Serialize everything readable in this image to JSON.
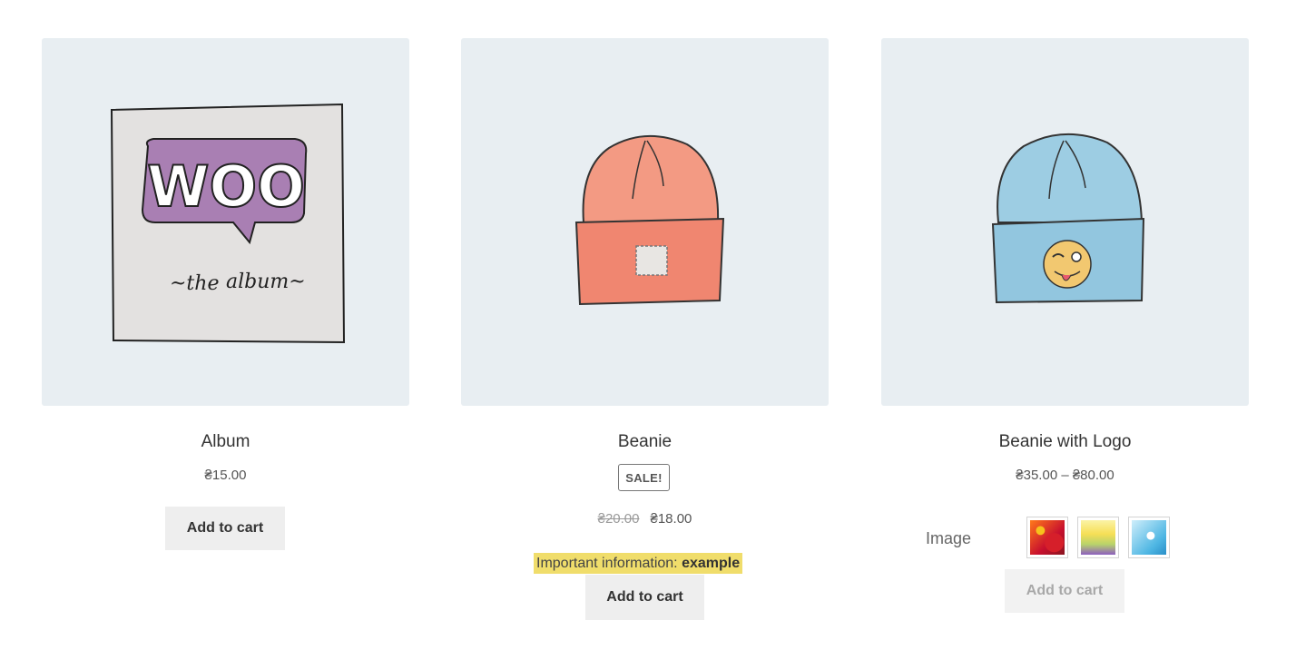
{
  "products": [
    {
      "name": "Album",
      "price": "₴15.00",
      "button": "Add to cart",
      "image_icon": "woo-album-cover-illustration"
    },
    {
      "name": "Beanie",
      "badge": "SALE!",
      "old_price": "₴20.00",
      "price": "₴18.00",
      "info_label": "Important information:",
      "info_value": "example",
      "button": "Add to cart",
      "image_icon": "orange-beanie-illustration"
    },
    {
      "name": "Beanie with Logo",
      "price": "₴35.00 – ₴80.00",
      "attribute_label": "Image",
      "swatches": [
        "red-flowers-swatch",
        "yellow-flowers-swatch",
        "blue-snowflake-swatch"
      ],
      "button": "Add to cart",
      "image_icon": "blue-beanie-with-logo-illustration"
    }
  ],
  "colors": {
    "image_bg": "#e8eef2",
    "button_bg": "#eeeeee",
    "info_highlight": "#f0dd6b",
    "album_purple": "#a97fb3",
    "beanie_orange": "#f08670",
    "beanie_blue": "#92c6df"
  }
}
